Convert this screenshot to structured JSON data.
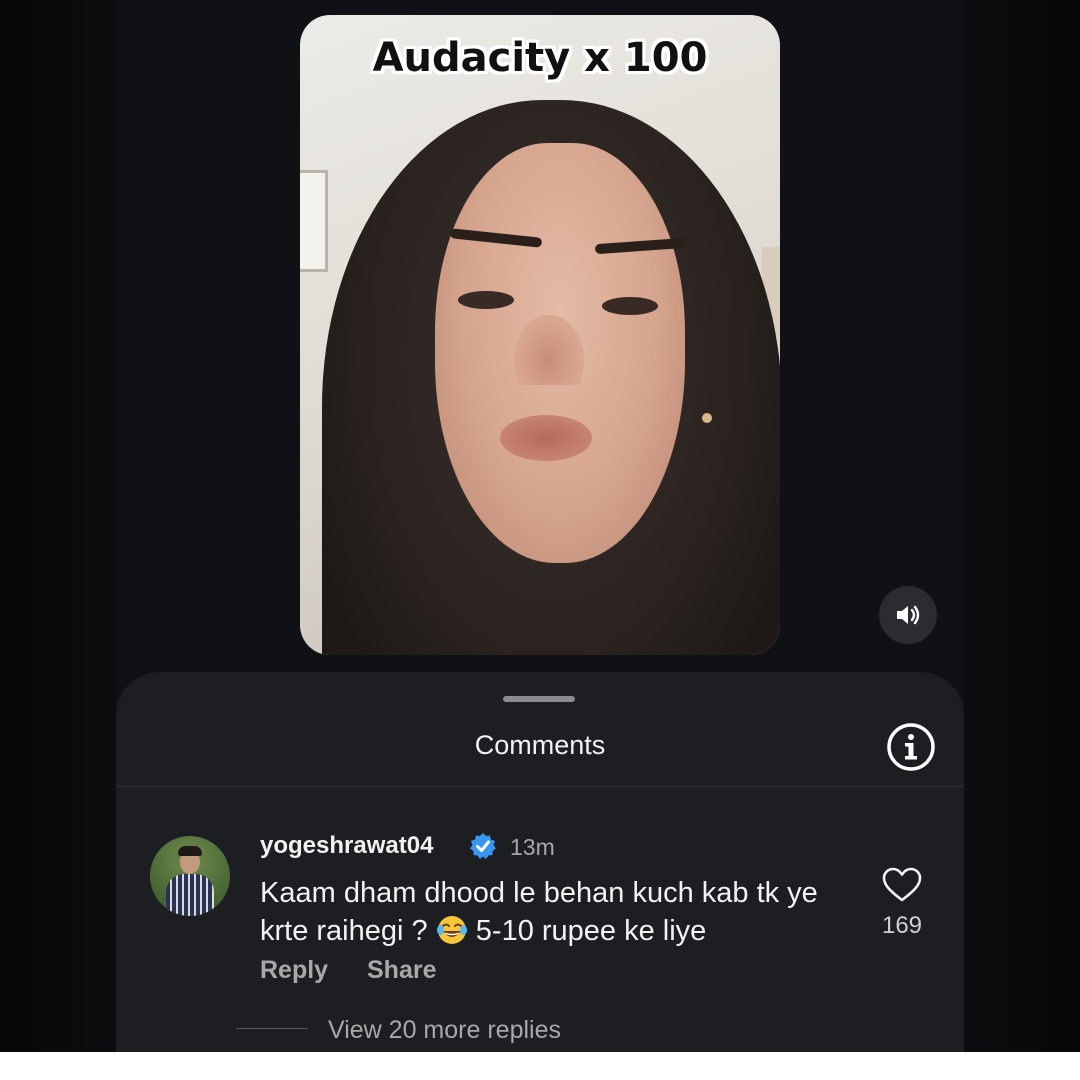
{
  "video": {
    "caption": "Audacity x 100",
    "sound_icon": "speaker-on-icon"
  },
  "comments_sheet": {
    "title": "Comments",
    "info_icon": "info-icon"
  },
  "comment": {
    "username": "yogeshrawat04",
    "verified_icon": "verified-badge-icon",
    "time": "13m",
    "text_part1": "Kaam dham dhood le behan kuch kab tk ye krte raihegi ?",
    "emoji": "face-with-tears-of-joy-emoji",
    "text_part2": "5-10 rupee ke liye",
    "reply_label": "Reply",
    "share_label": "Share",
    "like_icon": "heart-outline-icon",
    "like_count": "169",
    "view_replies": "View 20 more replies"
  },
  "colors": {
    "background": "#0f1115",
    "sheet": "#1c1e22",
    "verified": "#3897f0",
    "primary_text": "#f2f2f2",
    "secondary_text": "#a8a8a8"
  }
}
